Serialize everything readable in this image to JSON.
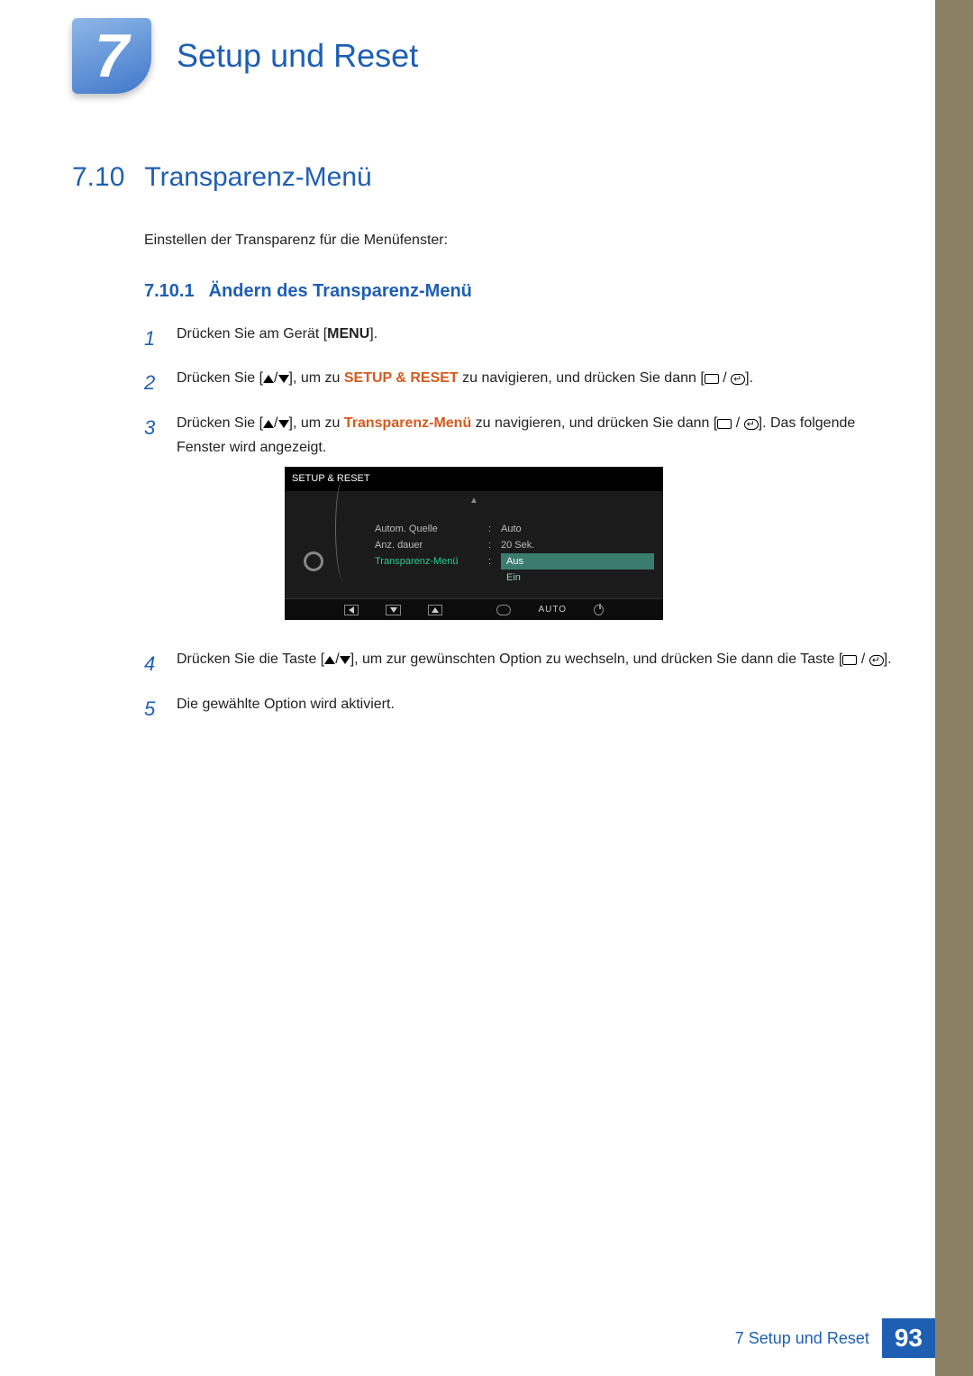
{
  "chapter": {
    "number": "7",
    "title": "Setup und Reset"
  },
  "h2": {
    "number": "7.10",
    "title": "Transparenz-Menü"
  },
  "intro": "Einstellen der Transparenz für die Menüfenster:",
  "h3": {
    "number": "7.10.1",
    "title": "Ändern des Transparenz-Menü"
  },
  "steps": {
    "s1": {
      "num": "1",
      "t1": "Drücken Sie am Gerät [",
      "menu": "MENU",
      "t2": "]."
    },
    "s2": {
      "num": "2",
      "t1": "Drücken Sie [",
      "t2": "], um zu ",
      "kw": "SETUP & RESET",
      "t3": " zu navigieren, und drücken Sie dann [",
      "t4": "]."
    },
    "s3": {
      "num": "3",
      "t1": "Drücken Sie [",
      "t2": "], um zu ",
      "kw": "Transparenz-Menü",
      "t3": " zu navigieren, und drücken Sie dann [",
      "t4": "]. Das folgende Fenster wird angezeigt."
    },
    "s4": {
      "num": "4",
      "t1": "Drücken Sie die Taste [",
      "t2": "], um zur gewünschten Option zu wechseln, und drücken Sie dann die Taste [",
      "t3": "]."
    },
    "s5": {
      "num": "5",
      "t1": "Die gewählte Option wird aktiviert."
    }
  },
  "osd": {
    "title": "SETUP & RESET",
    "rows": {
      "r1": {
        "label": "Autom. Quelle",
        "value": "Auto"
      },
      "r2": {
        "label": "Anz. dauer",
        "value": "20 Sek."
      },
      "r3": {
        "label": "Transparenz-Menü",
        "sel": "Aus",
        "opt2": "Ein"
      }
    },
    "footer_auto": "AUTO"
  },
  "footer": {
    "text": "7 Setup und Reset",
    "page": "93"
  }
}
